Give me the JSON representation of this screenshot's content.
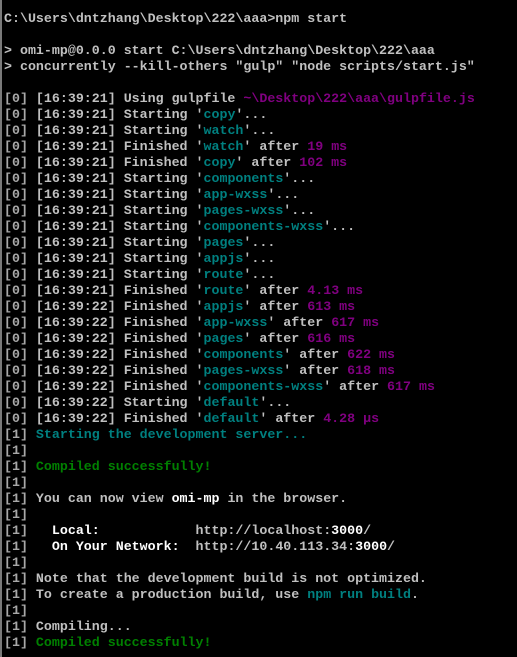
{
  "colors": {
    "text": "#c0c0c0",
    "bright": "#ffffff",
    "teal": "#008080",
    "purple": "#800080",
    "green": "#008000",
    "background": "#000000"
  },
  "lines": [
    [
      {
        "t": "C:\\Users\\dntzhang\\Desktop\\222\\aaa>npm start",
        "c": "g"
      }
    ],
    [],
    [
      {
        "t": "> omi-mp@0.0.0 start C:\\Users\\dntzhang\\Desktop\\222\\aaa",
        "c": "g"
      }
    ],
    [
      {
        "t": "> concurrently --kill-others \"gulp\" \"node scripts/start.js\"",
        "c": "g"
      }
    ],
    [],
    [
      {
        "t": "[0] ",
        "c": "d"
      },
      {
        "t": "[16:39:21] Using gulpfile ",
        "c": "g"
      },
      {
        "t": "~\\Desktop\\222\\aaa\\gulpfile.js",
        "c": "p"
      }
    ],
    [
      {
        "t": "[0] ",
        "c": "d"
      },
      {
        "t": "[16:39:21] Starting '",
        "c": "g"
      },
      {
        "t": "copy",
        "c": "t"
      },
      {
        "t": "'...",
        "c": "g"
      }
    ],
    [
      {
        "t": "[0] ",
        "c": "d"
      },
      {
        "t": "[16:39:21] Starting '",
        "c": "g"
      },
      {
        "t": "watch",
        "c": "t"
      },
      {
        "t": "'...",
        "c": "g"
      }
    ],
    [
      {
        "t": "[0] ",
        "c": "d"
      },
      {
        "t": "[16:39:21] Finished '",
        "c": "g"
      },
      {
        "t": "watch",
        "c": "t"
      },
      {
        "t": "' after ",
        "c": "g"
      },
      {
        "t": "19 ms",
        "c": "p"
      }
    ],
    [
      {
        "t": "[0] ",
        "c": "d"
      },
      {
        "t": "[16:39:21] Finished '",
        "c": "g"
      },
      {
        "t": "copy",
        "c": "t"
      },
      {
        "t": "' after ",
        "c": "g"
      },
      {
        "t": "102 ms",
        "c": "p"
      }
    ],
    [
      {
        "t": "[0] ",
        "c": "d"
      },
      {
        "t": "[16:39:21] Starting '",
        "c": "g"
      },
      {
        "t": "components",
        "c": "t"
      },
      {
        "t": "'...",
        "c": "g"
      }
    ],
    [
      {
        "t": "[0] ",
        "c": "d"
      },
      {
        "t": "[16:39:21] Starting '",
        "c": "g"
      },
      {
        "t": "app-wxss",
        "c": "t"
      },
      {
        "t": "'...",
        "c": "g"
      }
    ],
    [
      {
        "t": "[0] ",
        "c": "d"
      },
      {
        "t": "[16:39:21] Starting '",
        "c": "g"
      },
      {
        "t": "pages-wxss",
        "c": "t"
      },
      {
        "t": "'...",
        "c": "g"
      }
    ],
    [
      {
        "t": "[0] ",
        "c": "d"
      },
      {
        "t": "[16:39:21] Starting '",
        "c": "g"
      },
      {
        "t": "components-wxss",
        "c": "t"
      },
      {
        "t": "'...",
        "c": "g"
      }
    ],
    [
      {
        "t": "[0] ",
        "c": "d"
      },
      {
        "t": "[16:39:21] Starting '",
        "c": "g"
      },
      {
        "t": "pages",
        "c": "t"
      },
      {
        "t": "'...",
        "c": "g"
      }
    ],
    [
      {
        "t": "[0] ",
        "c": "d"
      },
      {
        "t": "[16:39:21] Starting '",
        "c": "g"
      },
      {
        "t": "appjs",
        "c": "t"
      },
      {
        "t": "'...",
        "c": "g"
      }
    ],
    [
      {
        "t": "[0] ",
        "c": "d"
      },
      {
        "t": "[16:39:21] Starting '",
        "c": "g"
      },
      {
        "t": "route",
        "c": "t"
      },
      {
        "t": "'...",
        "c": "g"
      }
    ],
    [
      {
        "t": "[0] ",
        "c": "d"
      },
      {
        "t": "[16:39:21] Finished '",
        "c": "g"
      },
      {
        "t": "route",
        "c": "t"
      },
      {
        "t": "' after ",
        "c": "g"
      },
      {
        "t": "4.13 ms",
        "c": "p"
      }
    ],
    [
      {
        "t": "[0] ",
        "c": "d"
      },
      {
        "t": "[16:39:22] Finished '",
        "c": "g"
      },
      {
        "t": "appjs",
        "c": "t"
      },
      {
        "t": "' after ",
        "c": "g"
      },
      {
        "t": "613 ms",
        "c": "p"
      }
    ],
    [
      {
        "t": "[0] ",
        "c": "d"
      },
      {
        "t": "[16:39:22] Finished '",
        "c": "g"
      },
      {
        "t": "app-wxss",
        "c": "t"
      },
      {
        "t": "' after ",
        "c": "g"
      },
      {
        "t": "617 ms",
        "c": "p"
      }
    ],
    [
      {
        "t": "[0] ",
        "c": "d"
      },
      {
        "t": "[16:39:22] Finished '",
        "c": "g"
      },
      {
        "t": "pages",
        "c": "t"
      },
      {
        "t": "' after ",
        "c": "g"
      },
      {
        "t": "616 ms",
        "c": "p"
      }
    ],
    [
      {
        "t": "[0] ",
        "c": "d"
      },
      {
        "t": "[16:39:22] Finished '",
        "c": "g"
      },
      {
        "t": "components",
        "c": "t"
      },
      {
        "t": "' after ",
        "c": "g"
      },
      {
        "t": "622 ms",
        "c": "p"
      }
    ],
    [
      {
        "t": "[0] ",
        "c": "d"
      },
      {
        "t": "[16:39:22] Finished '",
        "c": "g"
      },
      {
        "t": "pages-wxss",
        "c": "t"
      },
      {
        "t": "' after ",
        "c": "g"
      },
      {
        "t": "618 ms",
        "c": "p"
      }
    ],
    [
      {
        "t": "[0] ",
        "c": "d"
      },
      {
        "t": "[16:39:22] Finished '",
        "c": "g"
      },
      {
        "t": "components-wxss",
        "c": "t"
      },
      {
        "t": "' after ",
        "c": "g"
      },
      {
        "t": "617 ms",
        "c": "p"
      }
    ],
    [
      {
        "t": "[0] ",
        "c": "d"
      },
      {
        "t": "[16:39:22] Starting '",
        "c": "g"
      },
      {
        "t": "default",
        "c": "t"
      },
      {
        "t": "'...",
        "c": "g"
      }
    ],
    [
      {
        "t": "[0] ",
        "c": "d"
      },
      {
        "t": "[16:39:22] Finished '",
        "c": "g"
      },
      {
        "t": "default",
        "c": "t"
      },
      {
        "t": "' after ",
        "c": "g"
      },
      {
        "t": "4.28 μs",
        "c": "p"
      }
    ],
    [
      {
        "t": "[1] ",
        "c": "d"
      },
      {
        "t": "Starting the development server...",
        "c": "t"
      }
    ],
    [
      {
        "t": "[1]",
        "c": "d"
      }
    ],
    [
      {
        "t": "[1] ",
        "c": "d"
      },
      {
        "t": "Compiled successfully!",
        "c": "gr"
      }
    ],
    [
      {
        "t": "[1]",
        "c": "d"
      }
    ],
    [
      {
        "t": "[1] ",
        "c": "d"
      },
      {
        "t": "You can now view ",
        "c": "g"
      },
      {
        "t": "omi-mp",
        "c": "w"
      },
      {
        "t": " in the browser.",
        "c": "g"
      }
    ],
    [
      {
        "t": "[1]",
        "c": "d"
      }
    ],
    [
      {
        "t": "[1] ",
        "c": "d"
      },
      {
        "t": "  Local:",
        "c": "w"
      },
      {
        "t": "            http://localhost:",
        "c": "g"
      },
      {
        "t": "3000",
        "c": "w"
      },
      {
        "t": "/",
        "c": "g"
      }
    ],
    [
      {
        "t": "[1] ",
        "c": "d"
      },
      {
        "t": "  On Your Network:",
        "c": "w"
      },
      {
        "t": "  http://10.40.113.34:",
        "c": "g"
      },
      {
        "t": "3000",
        "c": "w"
      },
      {
        "t": "/",
        "c": "g"
      }
    ],
    [
      {
        "t": "[1]",
        "c": "d"
      }
    ],
    [
      {
        "t": "[1] ",
        "c": "d"
      },
      {
        "t": "Note that the development build is not optimized.",
        "c": "g"
      }
    ],
    [
      {
        "t": "[1] ",
        "c": "d"
      },
      {
        "t": "To create a production build, use ",
        "c": "g"
      },
      {
        "t": "npm run build",
        "c": "t"
      },
      {
        "t": ".",
        "c": "g"
      }
    ],
    [
      {
        "t": "[1]",
        "c": "d"
      }
    ],
    [
      {
        "t": "[1] ",
        "c": "d"
      },
      {
        "t": "Compiling...",
        "c": "g"
      }
    ],
    [
      {
        "t": "[1] ",
        "c": "d"
      },
      {
        "t": "Compiled successfully!",
        "c": "gr"
      }
    ]
  ]
}
